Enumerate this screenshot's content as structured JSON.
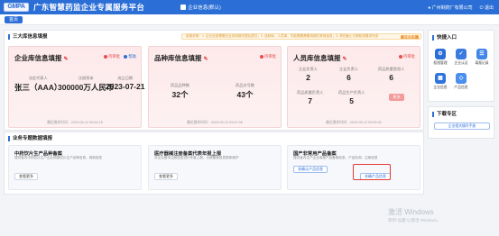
{
  "header": {
    "logo_text": "GMPA",
    "app_title": "广东智慧药监企业专属服务平台",
    "org_switch": "企业信息(默认)",
    "user": "广州制药厂有限公司",
    "logout": "退出"
  },
  "tabs": {
    "home": "首页"
  },
  "info_panel": {
    "title": "三大库信息填报",
    "notice": "填报说明：1. 企业信息需要在此处填报完整后提交；2. 品种库、人员库、可能需要需要填报的其他信息；3. 请在截止日期前按要求完成",
    "notice_button": "查看更多"
  },
  "cards": [
    {
      "title": "企业库信息填报",
      "link_review": "待审批",
      "link_help": "帮助",
      "stats": [
        {
          "label": "法定代表人",
          "value": "张三（AAA）"
        },
        {
          "label": "注册资本",
          "value": "300000万人民币"
        },
        {
          "label": "成立日期",
          "value": "2023-07-21"
        }
      ],
      "update_time": "最近操作时间：2023-05-12 09:54:15"
    },
    {
      "title": "品种库信息填报",
      "link_review": "待审批",
      "stats": [
        {
          "label": "药品品种数",
          "value": "32个"
        },
        {
          "label": "药品文号数",
          "value": "43个"
        }
      ],
      "update_time": "最近操作时间：2023-05-12 09:57:06"
    },
    {
      "title": "人员库信息填报",
      "link_review": "待审批",
      "stats": [
        {
          "label": "企业负责人",
          "value": "2"
        },
        {
          "label": "企业负责人",
          "value": "6"
        },
        {
          "label": "药品质量受权人",
          "value": "6"
        },
        {
          "label": "药品质量负责人",
          "value": "7"
        },
        {
          "label": "药品生产负责人",
          "value": "5"
        }
      ],
      "more_button": "更多",
      "update_time": "最近操作时间：2023-05-12 09:59:02"
    }
  ],
  "special_panel": {
    "title": "业务专题数据填报",
    "items": [
      {
        "title": "中药饮片生产品种备案",
        "desc": "提供省内中药饮片生产企业填报饮片生产品种信息、炮制信息",
        "buttons": [
          "查看更多"
        ]
      },
      {
        "title": "医疗器械注册备案代表年报上报",
        "desc": "对企业基本注册信息进行年度上报，以便备案信息更新维护",
        "buttons": [
          "查看更多"
        ]
      },
      {
        "title": "国产非常用产品备案",
        "desc": "提供省内生产企业填报产品备案信息、产品检测、注册信息",
        "buttons": [
          "非确认产品信息",
          "非确产品信息"
        ]
      }
    ]
  },
  "quick_entry": {
    "title": "快捷入口",
    "items": [
      {
        "label": "权限管理",
        "icon": "key-icon"
      },
      {
        "label": "企业认证",
        "icon": "certificate-icon"
      },
      {
        "label": "填报记录",
        "icon": "record-icon"
      },
      {
        "label": "企业信息",
        "icon": "building-icon"
      },
      {
        "label": "产品信息",
        "icon": "product-icon"
      }
    ]
  },
  "download": {
    "title": "下载专区",
    "link": "企业相关操作手册"
  },
  "watermark": {
    "line1": "激活 Windows",
    "line2": "转到“设置”以激活 Windows。"
  }
}
